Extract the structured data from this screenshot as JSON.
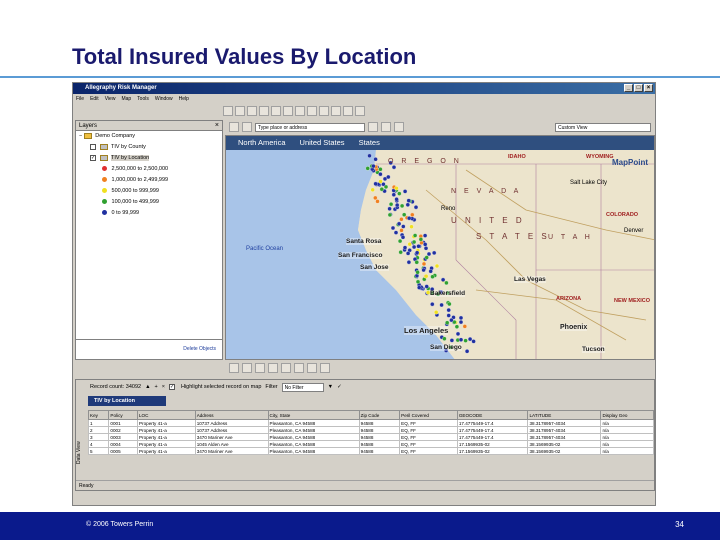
{
  "slide": {
    "title": "Total Insured Values By Location",
    "copyright": "© 2006 Towers Perrin",
    "page_number": "34"
  },
  "app": {
    "window_title": "Allegraphy Risk Manager",
    "menu": [
      "File",
      "Edit",
      "View",
      "Map",
      "Tools",
      "Window",
      "Help"
    ],
    "layers_panel": {
      "title": "Layers",
      "items": [
        {
          "label": "Demo Company",
          "type": "folder"
        },
        {
          "label": "TIV by County",
          "type": "layer"
        },
        {
          "label": "TIV by Location",
          "type": "layer"
        }
      ],
      "legend": [
        {
          "label": "2,500,000 to 2,500,000",
          "color": "#e03030"
        },
        {
          "label": "1,000,000 to 2,499,999",
          "color": "#f08020"
        },
        {
          "label": "500,000 to 999,999",
          "color": "#f0e020"
        },
        {
          "label": "100,000 to 499,999",
          "color": "#30a030"
        },
        {
          "label": "0 to 99,999",
          "color": "#2030a0"
        }
      ],
      "delete_objects": "Delete Objects"
    },
    "map_toolbar": {
      "search_placeholder": "Type place or address",
      "select_value": "Custom View"
    },
    "map": {
      "header_tabs": [
        "North America",
        "United States",
        "States"
      ],
      "brand": "MapPoint",
      "labels": {
        "oregon": "O R E G O N",
        "idaho": "IDAHO",
        "wyoming": "WYOMING",
        "nevada": "N E V A D A",
        "united": "U N I T E D",
        "states": "S T A T E S",
        "utah": "U T A H",
        "colorado": "COLORADO",
        "arizona": "ARIZONA",
        "new_mexico": "NEW MEXICO",
        "pacific_ocean": "Pacific Ocean",
        "santa_rosa": "Santa Rosa",
        "san_francisco": "San Francisco",
        "san_jose": "San Jose",
        "bakersfield": "Bakersfield",
        "los_angeles": "Los Angeles",
        "san_diego": "San Diego",
        "las_vegas": "Las Vegas",
        "phoenix": "Phoenix",
        "tucson": "Tucson",
        "salt_lake_city": "Salt Lake City",
        "reno": "Reno",
        "denver": "Denver"
      }
    },
    "data_panel": {
      "record_count": "Record count: 34092",
      "highlight_label": "Highlight selected record on map",
      "filter_label": "Filter",
      "filter_value": "No Filter",
      "tab": "TIV by Location",
      "side_label": "Data View",
      "columns": [
        "Key",
        "Policy",
        "LOC",
        "Address",
        "City, State",
        "Zip Code",
        "Peril Covered",
        "GEOCODE",
        "LATITUDE",
        "Display Geo"
      ],
      "rows": [
        [
          "1",
          "0001",
          "Property 41-a",
          "10737 Address",
          "Pleasanton, CA 94588",
          "94588",
          "EQ, FF",
          "17.4775449-17.4",
          "38.3178957-4034",
          "n/a"
        ],
        [
          "2",
          "0002",
          "Property 41-a",
          "10737 Address",
          "Pleasanton, CA 94588",
          "94588",
          "EQ, FF",
          "17.4775449-17.4",
          "38.3178957-4034",
          "n/a"
        ],
        [
          "3",
          "0003",
          "Property 41-a",
          "3470 Mariner Ave",
          "Pleasanton, CA 94588",
          "94588",
          "EQ, FF",
          "17.4775449-17.4",
          "38.3178957-4034",
          "n/a"
        ],
        [
          "4",
          "0004",
          "Property 41-a",
          "1045 Alden Ave",
          "Pleasanton, CA 94588",
          "94588",
          "EQ, FF",
          "17.1569935-02",
          "38.1569935-02",
          "n/a"
        ],
        [
          "5",
          "0005",
          "Property 41-a",
          "3470 Mariner Ave",
          "Pleasanton, CA 94588",
          "94588",
          "EQ, FF",
          "17.1569935-02",
          "38.1569935-02",
          "n/a"
        ]
      ]
    },
    "status": "Ready"
  }
}
